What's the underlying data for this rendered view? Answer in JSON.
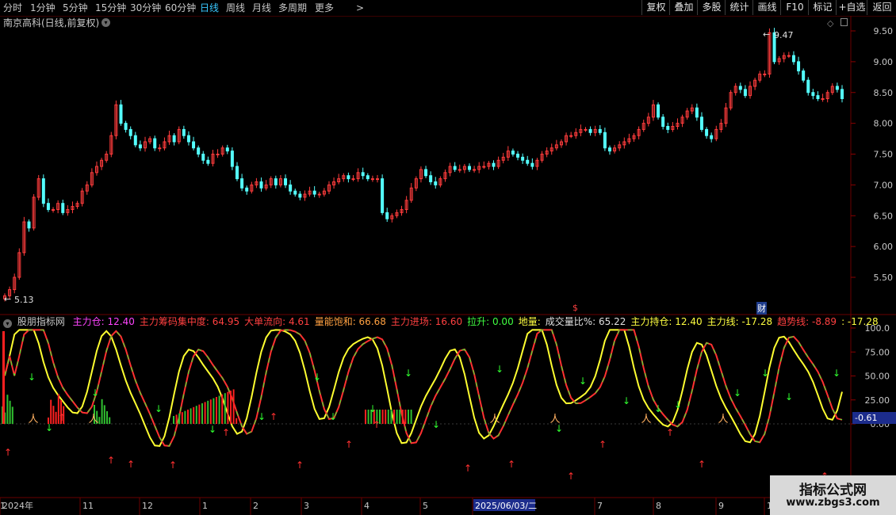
{
  "toolbar": {
    "periods": [
      "分时",
      "1分钟",
      "5分钟",
      "15分钟",
      "30分钟",
      "60分钟",
      "日线",
      "周线",
      "月线",
      "多周期",
      "更多"
    ],
    "active": "日线",
    "more_arrow": ">",
    "right_buttons": [
      "复权",
      "叠加",
      "多股",
      "统计",
      "画线",
      "F10",
      "标记",
      "+自选",
      "返回"
    ]
  },
  "main_chart": {
    "title": "南京高科(日线,前复权)",
    "y_ticks": [
      "9.50",
      "9.00",
      "8.50",
      "8.00",
      "7.50",
      "7.00",
      "6.50",
      "6.00",
      "5.50"
    ],
    "high_label": "9.47",
    "low_label": "5.13",
    "marker_dollar": "$",
    "marker_fin": "财",
    "colors": {
      "up": "#ff3c3c",
      "down": "#54ffff",
      "background": "#000000",
      "grid": "#5a0000"
    }
  },
  "indicator": {
    "name": "股朋指标网",
    "items": [
      {
        "label": "主力仓:",
        "value": "12.40",
        "color": "#ff44ff"
      },
      {
        "label": "主力筹码集中度:",
        "value": "64.95",
        "color": "#ff4040"
      },
      {
        "label": "大单流向:",
        "value": "4.61",
        "color": "#ff4040"
      },
      {
        "label": "量能饱和:",
        "value": "66.68",
        "color": "#ffa040"
      },
      {
        "label": "主力进场:",
        "value": "16.60",
        "color": "#ff4040"
      },
      {
        "label": "拉升:",
        "value": "0.00",
        "color": "#40ff40"
      },
      {
        "label": "地量:",
        "value": "",
        "color": "#ffff40"
      },
      {
        "label": "成交量比%:",
        "value": "65.22",
        "color": "#e0e0e0"
      },
      {
        "label": "主力持仓:",
        "value": "12.40",
        "color": "#ffff40"
      },
      {
        "label": "主力线:",
        "value": "-17.28",
        "color": "#ffff40"
      },
      {
        "label": "趋势线:",
        "value": "-8.89",
        "color": "#ff4040"
      },
      {
        "label": ":",
        "value": "-17.28",
        "color": "#ffff40"
      }
    ],
    "y_ticks": [
      "100.0",
      "75.00",
      "50.00",
      "25.00",
      "0.00"
    ],
    "current_value": "-0.61"
  },
  "date_axis": [
    "2024年",
    "11",
    "12",
    "1",
    "2",
    "3",
    "4",
    "5",
    "2025/06/03/二",
    "7",
    "8",
    "9",
    "10",
    "1"
  ],
  "watermark": {
    "line1": "指标公式网",
    "line2": "www.zbgs3.com"
  },
  "series": {
    "closes": [
      5.2,
      5.3,
      5.5,
      5.9,
      6.4,
      6.3,
      6.8,
      7.1,
      6.7,
      6.6,
      6.6,
      6.7,
      6.55,
      6.6,
      6.65,
      6.7,
      6.9,
      7.0,
      7.2,
      7.3,
      7.4,
      7.5,
      7.8,
      8.3,
      8.0,
      7.9,
      7.8,
      7.65,
      7.6,
      7.7,
      7.75,
      7.6,
      7.6,
      7.7,
      7.8,
      7.7,
      7.9,
      7.8,
      7.7,
      7.6,
      7.5,
      7.4,
      7.35,
      7.5,
      7.5,
      7.6,
      7.55,
      7.3,
      7.1,
      6.95,
      6.9,
      7.0,
      7.05,
      6.95,
      7.0,
      7.1,
      7.0,
      7.1,
      7.0,
      6.9,
      6.85,
      6.8,
      6.85,
      6.9,
      6.85,
      6.85,
      6.9,
      7.0,
      7.05,
      7.1,
      7.15,
      7.1,
      7.1,
      7.2,
      7.15,
      7.1,
      7.1,
      7.1,
      6.55,
      6.45,
      6.5,
      6.55,
      6.6,
      6.75,
      6.95,
      7.1,
      7.25,
      7.15,
      7.05,
      7.0,
      7.1,
      7.2,
      7.3,
      7.25,
      7.25,
      7.3,
      7.25,
      7.25,
      7.3,
      7.3,
      7.35,
      7.3,
      7.4,
      7.45,
      7.55,
      7.5,
      7.45,
      7.4,
      7.35,
      7.3,
      7.4,
      7.5,
      7.55,
      7.6,
      7.65,
      7.7,
      7.8,
      7.8,
      7.85,
      7.9,
      7.9,
      7.85,
      7.9,
      7.85,
      7.6,
      7.55,
      7.6,
      7.65,
      7.7,
      7.75,
      7.8,
      7.9,
      8.0,
      8.1,
      8.3,
      8.1,
      7.95,
      7.9,
      7.95,
      8.0,
      8.1,
      8.2,
      8.25,
      8.1,
      7.9,
      7.8,
      7.75,
      7.9,
      8.0,
      8.25,
      8.5,
      8.6,
      8.55,
      8.45,
      8.6,
      8.7,
      8.8,
      8.8,
      9.47,
      9.0,
      9.05,
      9.1,
      9.1,
      9.0,
      8.85,
      8.7,
      8.5,
      8.45,
      8.4,
      8.4,
      8.5,
      8.6,
      8.55,
      8.4
    ]
  }
}
